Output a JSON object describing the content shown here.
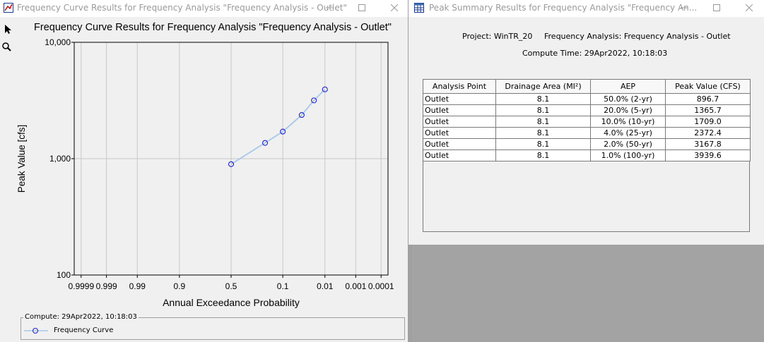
{
  "left_window": {
    "title": "Frequency Curve Results for Frequency Analysis \"Frequency Analysis - Outlet\""
  },
  "right_window": {
    "title": "Peak Summary Results for Frequency Analysis \"Frequency An...",
    "project": "Project: WinTR_20",
    "analysis": "Frequency Analysis: Frequency Analysis - Outlet",
    "compute_time": "Compute Time: 29Apr2022, 10:18:03",
    "table": {
      "headers": [
        "Analysis Point",
        "Drainage Area (MI²)",
        "AEP",
        "Peak Value (CFS)"
      ],
      "rows": [
        [
          "Outlet",
          "8.1",
          "50.0% (2-yr)",
          "896.7"
        ],
        [
          "Outlet",
          "8.1",
          "20.0% (5-yr)",
          "1365.7"
        ],
        [
          "Outlet",
          "8.1",
          "10.0% (10-yr)",
          "1709.0"
        ],
        [
          "Outlet",
          "8.1",
          "4.0% (25-yr)",
          "2372.4"
        ],
        [
          "Outlet",
          "8.1",
          "2.0% (50-yr)",
          "3167.8"
        ],
        [
          "Outlet",
          "8.1",
          "1.0% (100-yr)",
          "3939.6"
        ]
      ]
    }
  },
  "legend": {
    "title": "Compute: 29Apr2022, 10:18:03",
    "item": "Frequency Curve"
  },
  "chart_data": {
    "type": "line",
    "title": "Frequency Curve Results for Frequency Analysis \"Frequency Analysis - Outlet\"",
    "xlabel": "Annual Exceedance Probability",
    "ylabel": "Peak Value [cfs]",
    "x_scale": "normal-probability",
    "y_scale": "log",
    "ylim": [
      100,
      10000
    ],
    "x_ticks": [
      "0.9999",
      "0.999",
      "0.99",
      "0.9",
      "0.5",
      "0.1",
      "0.01",
      "0.001",
      "0.0001"
    ],
    "x_tick_values": [
      0.9999,
      0.999,
      0.99,
      0.9,
      0.5,
      0.1,
      0.01,
      0.001,
      0.0001
    ],
    "y_ticks": [
      "100",
      "1,000",
      "10,000"
    ],
    "y_tick_values": [
      100,
      1000,
      10000
    ],
    "grid": true,
    "series": [
      {
        "name": "Frequency Curve",
        "x": [
          0.5,
          0.2,
          0.1,
          0.04,
          0.02,
          0.01
        ],
        "y": [
          896.7,
          1365.7,
          1709.0,
          2372.4,
          3167.8,
          3939.6
        ],
        "color": "#a8c8e8",
        "marker_color": "#2020d0"
      }
    ]
  }
}
